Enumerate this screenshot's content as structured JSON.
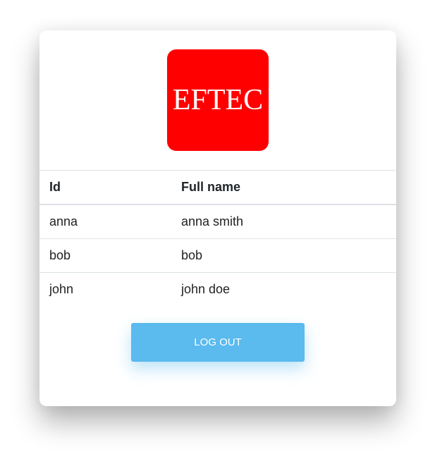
{
  "logo": {
    "text": "EFTEC",
    "bg_color": "#ff0000"
  },
  "table": {
    "headers": {
      "id": "Id",
      "name": "Full name"
    },
    "rows": [
      {
        "id": "anna",
        "name": "anna smith"
      },
      {
        "id": "bob",
        "name": "bob"
      },
      {
        "id": "john",
        "name": "john doe"
      }
    ]
  },
  "actions": {
    "logout_label": "LOG OUT",
    "logout_color": "#5bbaee"
  }
}
